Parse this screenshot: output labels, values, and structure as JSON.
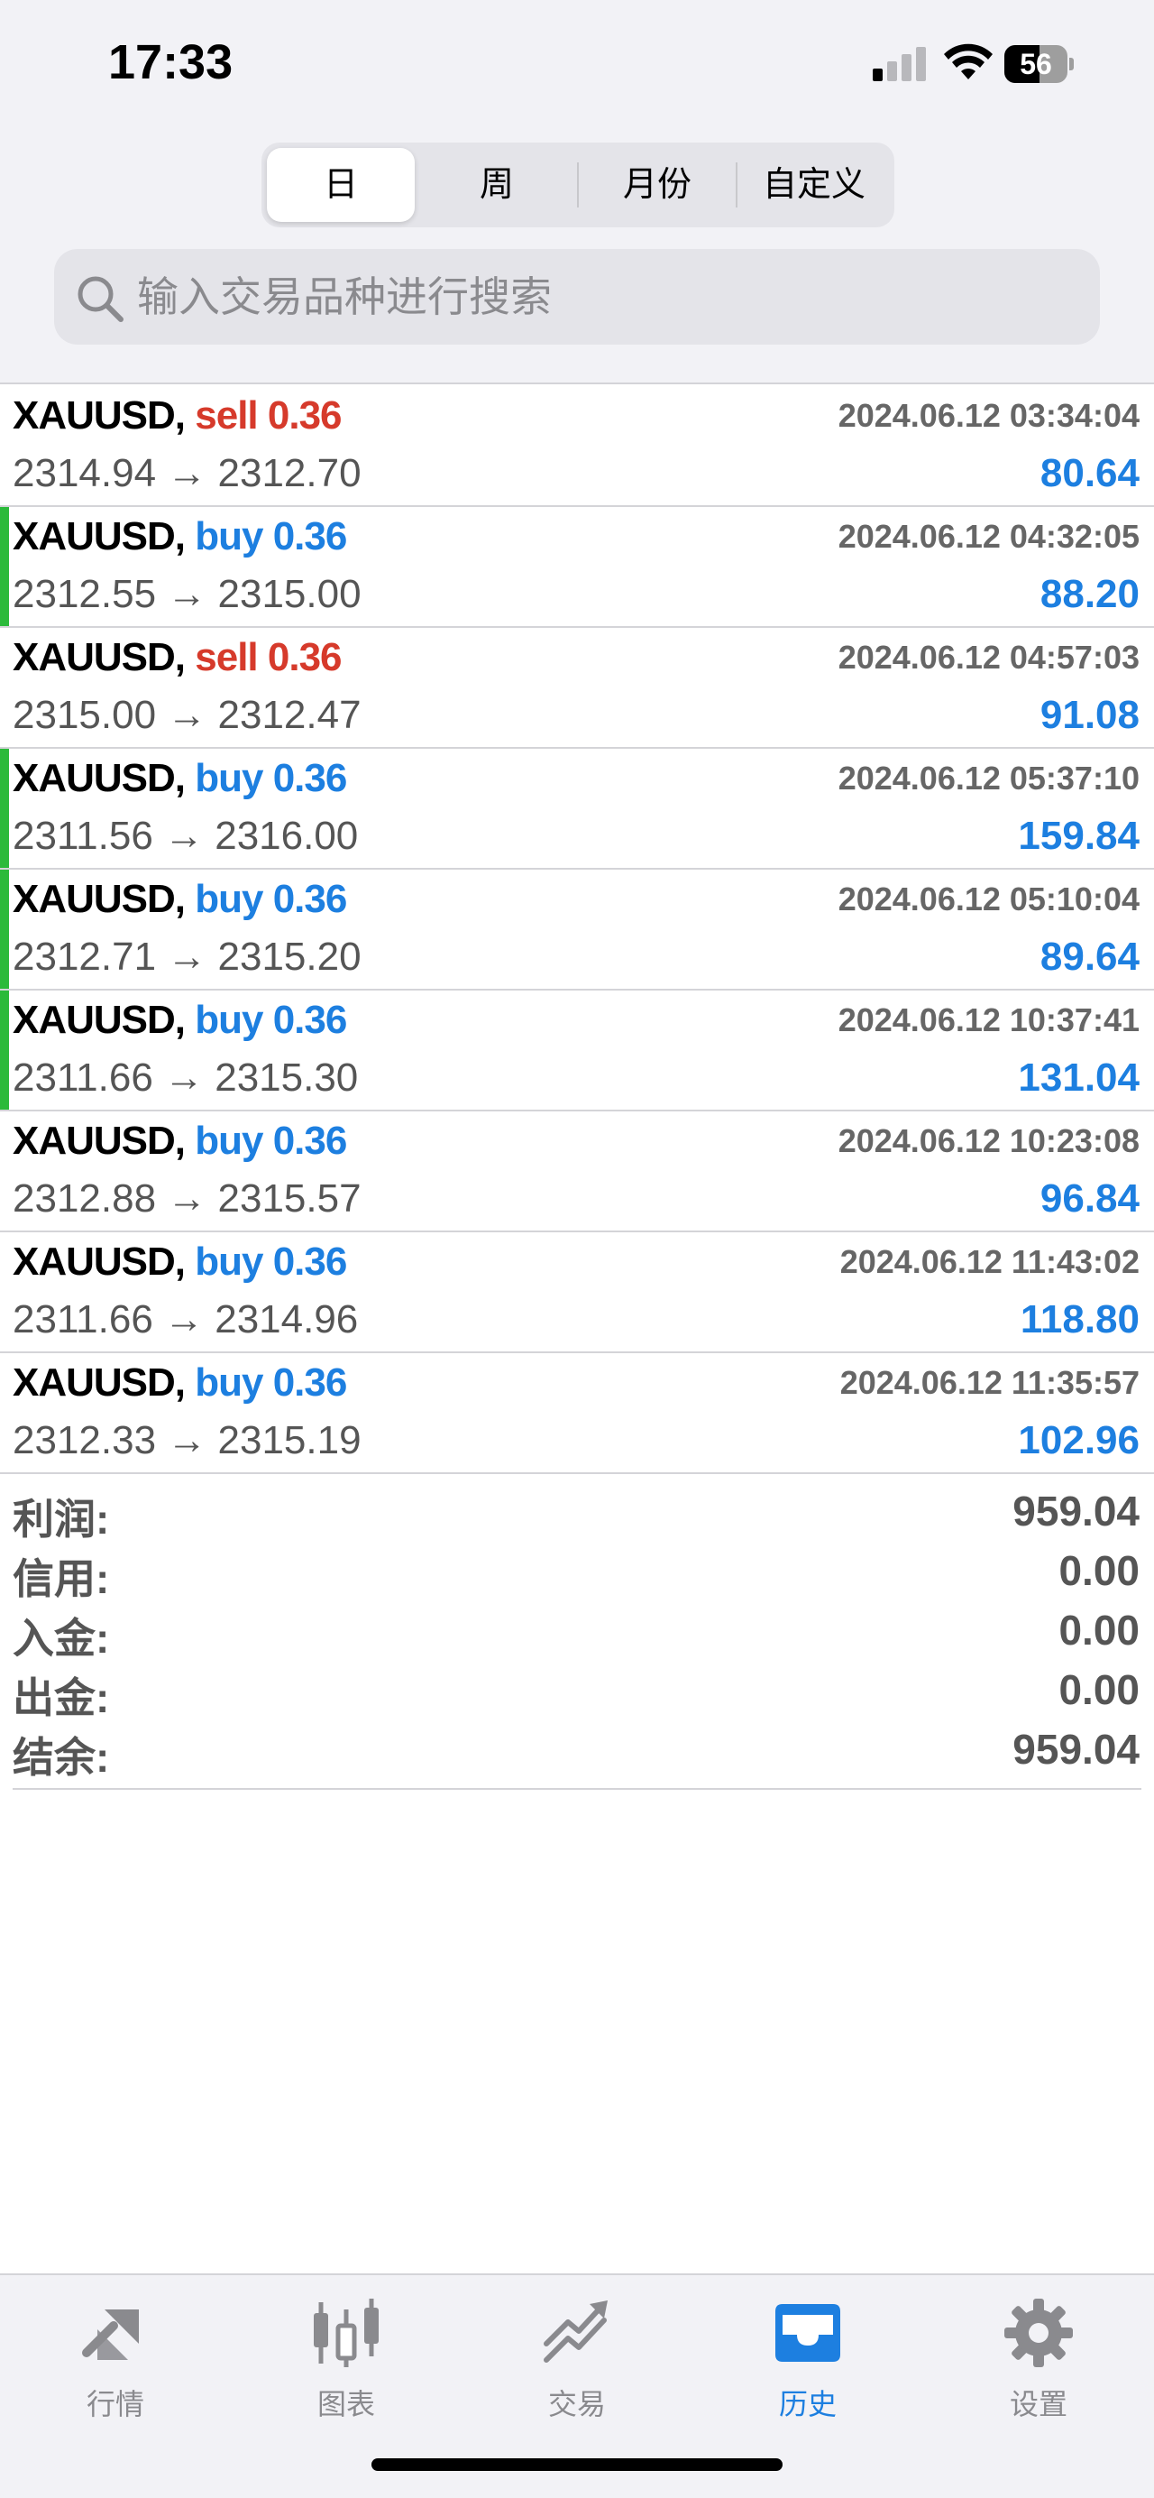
{
  "status_bar": {
    "time": "17:33",
    "battery": "56"
  },
  "header": {
    "segments": [
      "日",
      "周",
      "月份",
      "自定义"
    ],
    "search_placeholder": "输入交易品种进行搜索"
  },
  "trades": [
    {
      "symbol": "XAUUSD,",
      "side": "sell 0.36",
      "date": "2024.06.12 03:34:04",
      "prices": "2314.94 → 2312.70",
      "profit": "80.64"
    },
    {
      "symbol": "XAUUSD,",
      "side": "buy 0.36",
      "date": "2024.06.12 04:32:05",
      "prices": "2312.55 → 2315.00",
      "profit": "88.20"
    },
    {
      "symbol": "XAUUSD,",
      "side": "sell 0.36",
      "date": "2024.06.12 04:57:03",
      "prices": "2315.00 → 2312.47",
      "profit": "91.08"
    },
    {
      "symbol": "XAUUSD,",
      "side": "buy 0.36",
      "date": "2024.06.12 05:37:10",
      "prices": "2311.56 → 2316.00",
      "profit": "159.84"
    },
    {
      "symbol": "XAUUSD,",
      "side": "buy 0.36",
      "date": "2024.06.12 05:10:04",
      "prices": "2312.71 → 2315.20",
      "profit": "89.64"
    },
    {
      "symbol": "XAUUSD,",
      "side": "buy 0.36",
      "date": "2024.06.12 10:37:41",
      "prices": "2311.66 → 2315.30",
      "profit": "131.04"
    },
    {
      "symbol": "XAUUSD,",
      "side": "buy 0.36",
      "date": "2024.06.12 10:23:08",
      "prices": "2312.88 → 2315.57",
      "profit": "96.84"
    },
    {
      "symbol": "XAUUSD,",
      "side": "buy 0.36",
      "date": "2024.06.12 11:43:02",
      "prices": "2311.66 → 2314.96",
      "profit": "118.80"
    },
    {
      "symbol": "XAUUSD,",
      "side": "buy 0.36",
      "date": "2024.06.12 11:35:57",
      "prices": "2312.33 → 2315.19",
      "profit": "102.96"
    }
  ],
  "summary": [
    {
      "label": "利润:",
      "value": "959.04"
    },
    {
      "label": "信用:",
      "value": "0.00"
    },
    {
      "label": "入金:",
      "value": "0.00"
    },
    {
      "label": "出金:",
      "value": "0.00"
    },
    {
      "label": "结余:",
      "value": "959.04"
    }
  ],
  "tabbar": {
    "items": [
      {
        "label": "行情",
        "icon": "quotes-arrows-icon"
      },
      {
        "label": "图表",
        "icon": "candlestick-chart-icon"
      },
      {
        "label": "交易",
        "icon": "trade-trend-icon"
      },
      {
        "label": "历史",
        "icon": "history-inbox-icon"
      },
      {
        "label": "设置",
        "icon": "gear-icon"
      }
    ]
  },
  "colors": {
    "sell": "#d63a2b",
    "buy": "#1d7fe0",
    "profit": "#1d7fe0",
    "accent": "#1d7fe0",
    "green_marker": "#2bba3a",
    "inactive": "#8a8a8e"
  }
}
